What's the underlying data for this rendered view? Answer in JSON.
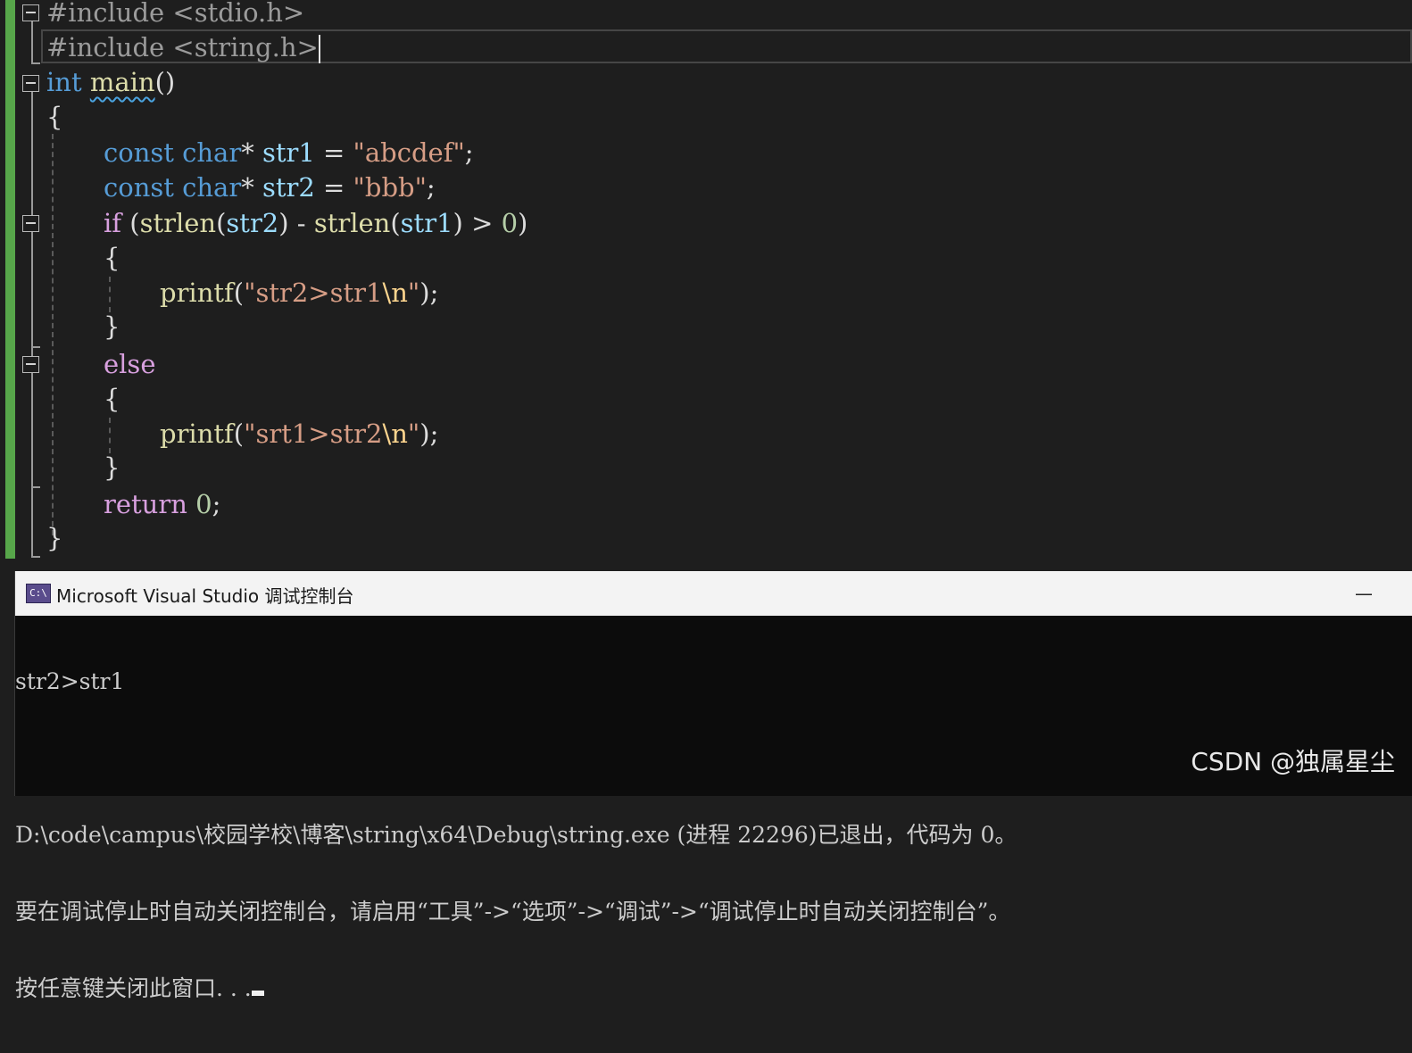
{
  "editor": {
    "lines": {
      "l1": {
        "text": "#include <stdio.h>"
      },
      "l2": {
        "text": "#include <string.h>"
      },
      "l3": {
        "kw": "int",
        "fn": "main",
        "rest": "()"
      },
      "l4": {
        "text": "{"
      },
      "l5": {
        "kw1": "const",
        "kw2": "char",
        "p1": "* ",
        "id": "str1",
        "p2": " = ",
        "str": "\"abcdef\"",
        "p3": ";"
      },
      "l6": {
        "kw1": "const",
        "kw2": "char",
        "p1": "* ",
        "id": "str2",
        "p2": " = ",
        "str": "\"bbb\"",
        "p3": ";"
      },
      "l7": {
        "ctrl": "if",
        "p1": " (",
        "fn1": "strlen",
        "p2": "(",
        "a1": "str2",
        "p3": ") - ",
        "fn2": "strlen",
        "p4": "(",
        "a2": "str1",
        "p5": ") > ",
        "num": "0",
        "p6": ")"
      },
      "l8": {
        "text": "{"
      },
      "l9": {
        "fn": "printf",
        "p1": "(",
        "s1": "\"str2>str1",
        "esc": "\\n",
        "s2": "\"",
        "p2": ");"
      },
      "l10": {
        "text": "}"
      },
      "l11": {
        "ctrl": "else"
      },
      "l12": {
        "text": "{"
      },
      "l13": {
        "fn": "printf",
        "p1": "(",
        "s1": "\"srt1>str2",
        "esc": "\\n",
        "s2": "\"",
        "p2": ");"
      },
      "l14": {
        "text": "}"
      },
      "l15": {
        "ctrl": "return",
        "sp": " ",
        "num": "0",
        "p": ";"
      },
      "l16": {
        "text": "}"
      }
    }
  },
  "console": {
    "title": "Microsoft Visual Studio 调试控制台",
    "icon_label": "C:\\",
    "minimize_label": "—",
    "output": {
      "line1": "str2>str1",
      "line2": "",
      "line3": "D:\\code\\campus\\校园学校\\博客\\string\\x64\\Debug\\string.exe (进程 22296)已退出，代码为 0。",
      "line4": "要在调试停止时自动关闭控制台，请启用“工具”->“选项”->“调试”->“调试停止时自动关闭控制台”。",
      "line5": "按任意键关闭此窗口. . ."
    }
  },
  "watermark": "CSDN @独属星尘",
  "colors": {
    "editor_bg": "#1e1e1e",
    "keyword": "#569cd6",
    "control_keyword": "#d8a0df",
    "function": "#dcdcaa",
    "string": "#d69d85",
    "number": "#b5cea8",
    "change_bar": "#57a64a",
    "console_bg": "#0c0c0c"
  }
}
